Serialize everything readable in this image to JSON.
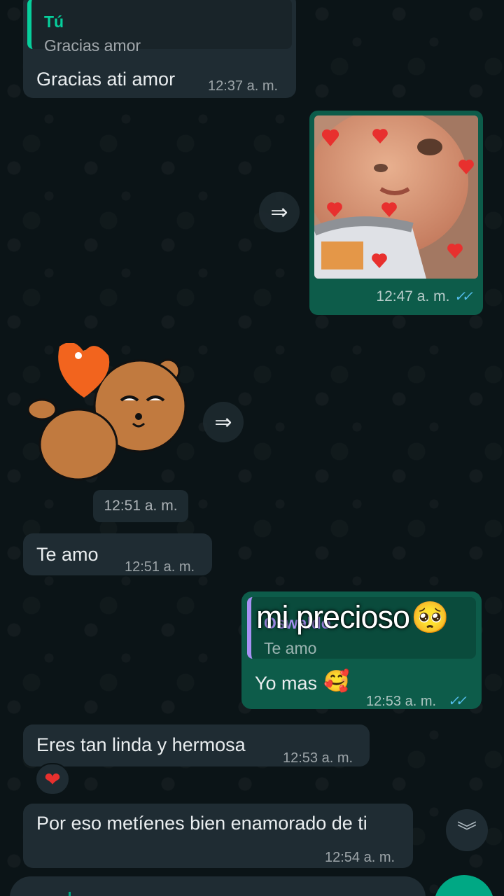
{
  "messages": {
    "reply_in": {
      "quote_author": "Tú",
      "quote_text": "Gracias amor",
      "text": "Gracias ati amor",
      "time": "12:37 a. m."
    },
    "photo_out": {
      "time": "12:47 a. m.",
      "ticks": "✓✓"
    },
    "sticker_in": {
      "time": "12:51 a. m."
    },
    "te_amo": {
      "text": "Te amo",
      "time": "12:51 a. m."
    },
    "reply_out": {
      "quote_author": "Oswaldo",
      "quote_text": "Te amo",
      "text": "Yo mas",
      "emoji": "🥰",
      "time": "12:53 a. m.",
      "ticks": "✓✓"
    },
    "eres": {
      "text": "Eres tan linda y hermosa",
      "time": "12:53 a. m.",
      "reaction": "❤"
    },
    "por_eso": {
      "text": "Por eso metíenes bien enamorado de ti",
      "time": "12:54 a. m."
    }
  },
  "overlay": {
    "text": "mi precioso",
    "emoji": "🥺"
  },
  "icons": {
    "forward": "forward-icon",
    "scroll_down": "double-chevron-down-icon",
    "colors": {
      "accent": "#00a884",
      "outgoing": "#0d5c4a",
      "incoming": "#1f2c33",
      "ticks": "#53bdeb"
    }
  },
  "buttons": {
    "forward_glyph": "⇒",
    "scroll_down_glyph": "︾"
  }
}
